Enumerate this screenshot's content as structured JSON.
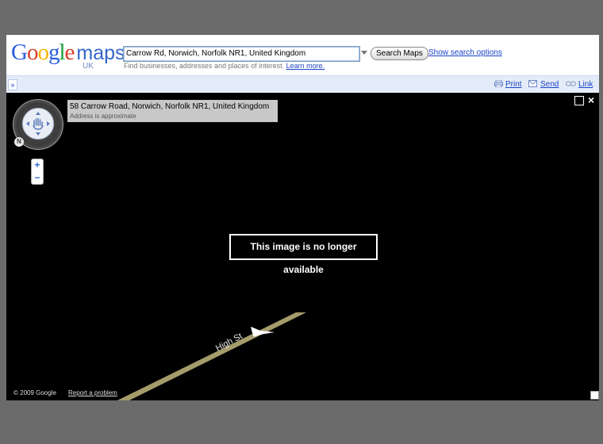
{
  "header": {
    "logo_google": "Google",
    "logo_maps": "maps",
    "logo_region": "UK",
    "search_value": "Carrow Rd, Norwich, Norfolk NR1, United Kingdom",
    "search_button": "Search Maps",
    "search_options": "Show search options",
    "hint": "Find businesses, addresses and places of interest.",
    "learn_more": "Learn more."
  },
  "toolbar": {
    "collapse": "»",
    "print": "Print",
    "send": "Send",
    "link": "Link"
  },
  "map": {
    "address_title": "58 Carrow Road, Norwich, Norfolk NR1, United Kingdom",
    "address_sub": "Address is approximate",
    "unavailable": "This image is no longer available",
    "street_name": "High St",
    "copyright": "© 2009 Google",
    "report": "Report a problem",
    "north": "N",
    "zoom_in": "+",
    "zoom_out": "−",
    "close": "×"
  }
}
